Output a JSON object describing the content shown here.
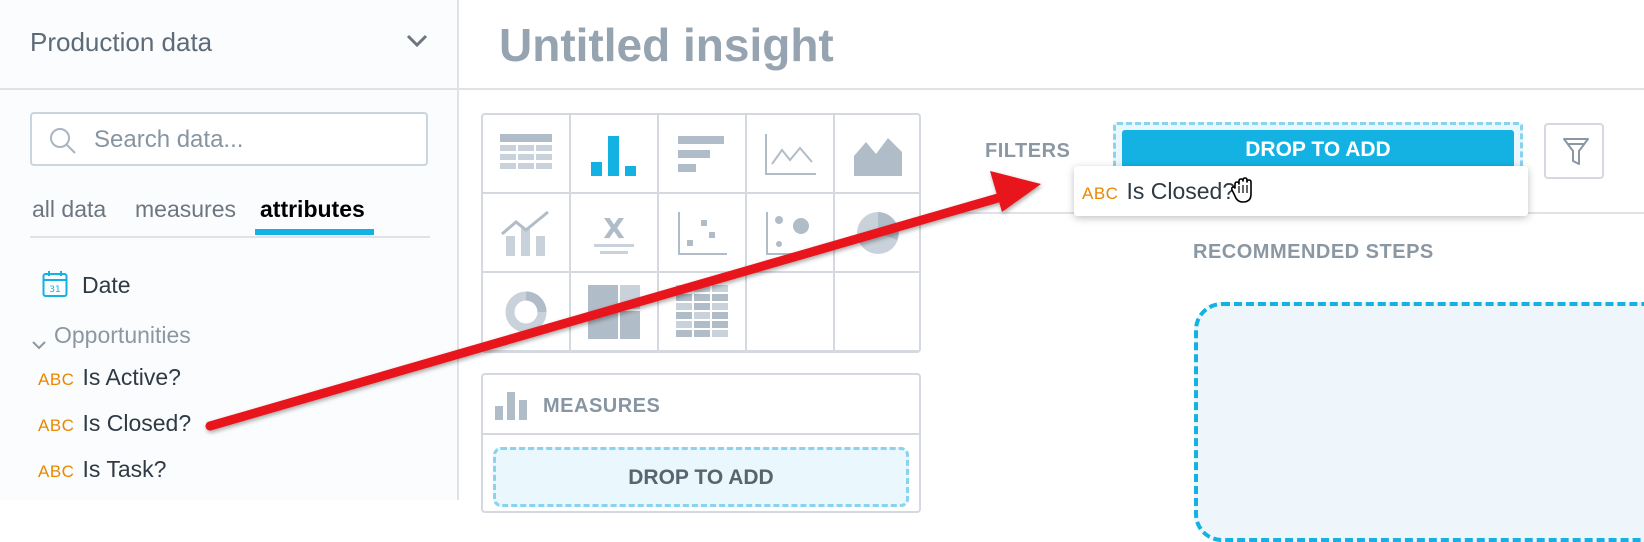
{
  "sidebar": {
    "project_name": "Production data",
    "search": {
      "placeholder": "Search data...",
      "value": ""
    },
    "tabs": [
      {
        "label": "all data",
        "active": false
      },
      {
        "label": "measures",
        "active": false
      },
      {
        "label": "attributes",
        "active": true
      }
    ],
    "date_item": {
      "label": "Date",
      "icon": "calendar-icon",
      "icon_text": "31"
    },
    "group": {
      "label": "Opportunities",
      "expanded": true
    },
    "attributes": [
      {
        "type_label": "ABC",
        "label": "Is Active?"
      },
      {
        "type_label": "ABC",
        "label": "Is Closed?"
      },
      {
        "type_label": "ABC",
        "label": "Is Task?"
      }
    ]
  },
  "header": {
    "title": "Untitled insight"
  },
  "visualization_types": [
    "table",
    "column-chart",
    "bar-chart",
    "line-chart",
    "area-chart",
    "combo-chart",
    "headline",
    "scatter-plot",
    "bubble-chart",
    "pie-chart",
    "donut-chart",
    "treemap",
    "heatmap"
  ],
  "measures_panel": {
    "title": "MEASURES",
    "drop_label": "DROP TO ADD"
  },
  "filters": {
    "label": "FILTERS",
    "drop_label": "DROP TO ADD"
  },
  "drag_preview": {
    "type_label": "ABC",
    "label": "Is Closed?"
  },
  "recommended": {
    "label": "RECOMMENDED STEPS"
  },
  "colors": {
    "accent": "#14b2e2",
    "attribute_type": "#e98700",
    "annotation_arrow": "#e8141b"
  }
}
